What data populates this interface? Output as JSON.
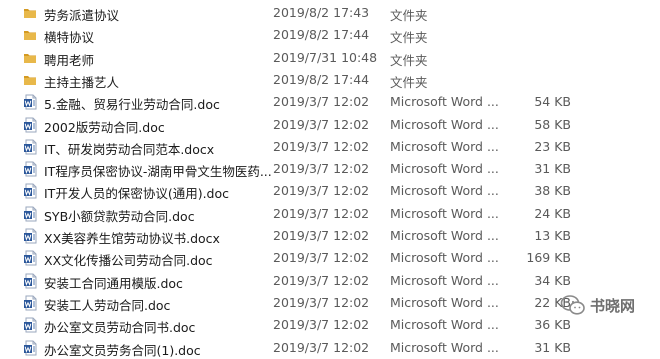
{
  "files": [
    {
      "name": "劳务派遣协议",
      "date": "2019/8/2 17:43",
      "type": "文件夹",
      "size": "",
      "kind": "folder-icon"
    },
    {
      "name": "横特协议",
      "date": "2019/8/2 17:44",
      "type": "文件夹",
      "size": "",
      "kind": "folder-icon"
    },
    {
      "name": "聘用老师",
      "date": "2019/7/31 10:48",
      "type": "文件夹",
      "size": "",
      "kind": "folder-icon"
    },
    {
      "name": "主持主播艺人",
      "date": "2019/8/2 17:44",
      "type": "文件夹",
      "size": "",
      "kind": "folder-icon"
    },
    {
      "name": "5.金融、贸易行业劳动合同.doc",
      "date": "2019/3/7 12:02",
      "type": "Microsoft Word ...",
      "size": "54 KB",
      "kind": "word-doc-icon"
    },
    {
      "name": "2002版劳动合同.doc",
      "date": "2019/3/7 12:02",
      "type": "Microsoft Word ...",
      "size": "58 KB",
      "kind": "word-doc-icon"
    },
    {
      "name": "IT、研发岗劳动合同范本.docx",
      "date": "2019/3/7 12:02",
      "type": "Microsoft Word ...",
      "size": "23 KB",
      "kind": "word-doc-icon"
    },
    {
      "name": "IT程序员保密协议-湖南甲骨文生物医药...",
      "date": "2019/3/7 12:02",
      "type": "Microsoft Word ...",
      "size": "31 KB",
      "kind": "word-doc-icon"
    },
    {
      "name": "IT开发人员的保密协议(通用).doc",
      "date": "2019/3/7 12:02",
      "type": "Microsoft Word ...",
      "size": "38 KB",
      "kind": "word-doc-icon"
    },
    {
      "name": "SYB小额贷款劳动合同.doc",
      "date": "2019/3/7 12:02",
      "type": "Microsoft Word ...",
      "size": "24 KB",
      "kind": "word-doc-icon"
    },
    {
      "name": "XX美容养生馆劳动协议书.docx",
      "date": "2019/3/7 12:02",
      "type": "Microsoft Word ...",
      "size": "13 KB",
      "kind": "word-doc-icon"
    },
    {
      "name": "XX文化传播公司劳动合同.doc",
      "date": "2019/3/7 12:02",
      "type": "Microsoft Word ...",
      "size": "169 KB",
      "kind": "word-doc-icon"
    },
    {
      "name": "安装工合同通用模版.doc",
      "date": "2019/3/7 12:02",
      "type": "Microsoft Word ...",
      "size": "34 KB",
      "kind": "word-doc-icon"
    },
    {
      "name": "安装工人劳动合同.doc",
      "date": "2019/3/7 12:02",
      "type": "Microsoft Word ...",
      "size": "22 KB",
      "kind": "word-doc-icon"
    },
    {
      "name": "办公室文员劳动合同书.doc",
      "date": "2019/3/7 12:02",
      "type": "Microsoft Word ...",
      "size": "36 KB",
      "kind": "word-doc-icon"
    },
    {
      "name": "办公室文员劳务合同(1).doc",
      "date": "2019/3/7 12:02",
      "type": "Microsoft Word ...",
      "size": "31 KB",
      "kind": "word-doc-icon"
    }
  ],
  "watermark": {
    "text": "书晓网",
    "kind": "wechat-logo-icon"
  },
  "colors": {
    "folder": "#e8b84a",
    "folder_dark": "#d49a22",
    "word_blue": "#2b579a"
  }
}
